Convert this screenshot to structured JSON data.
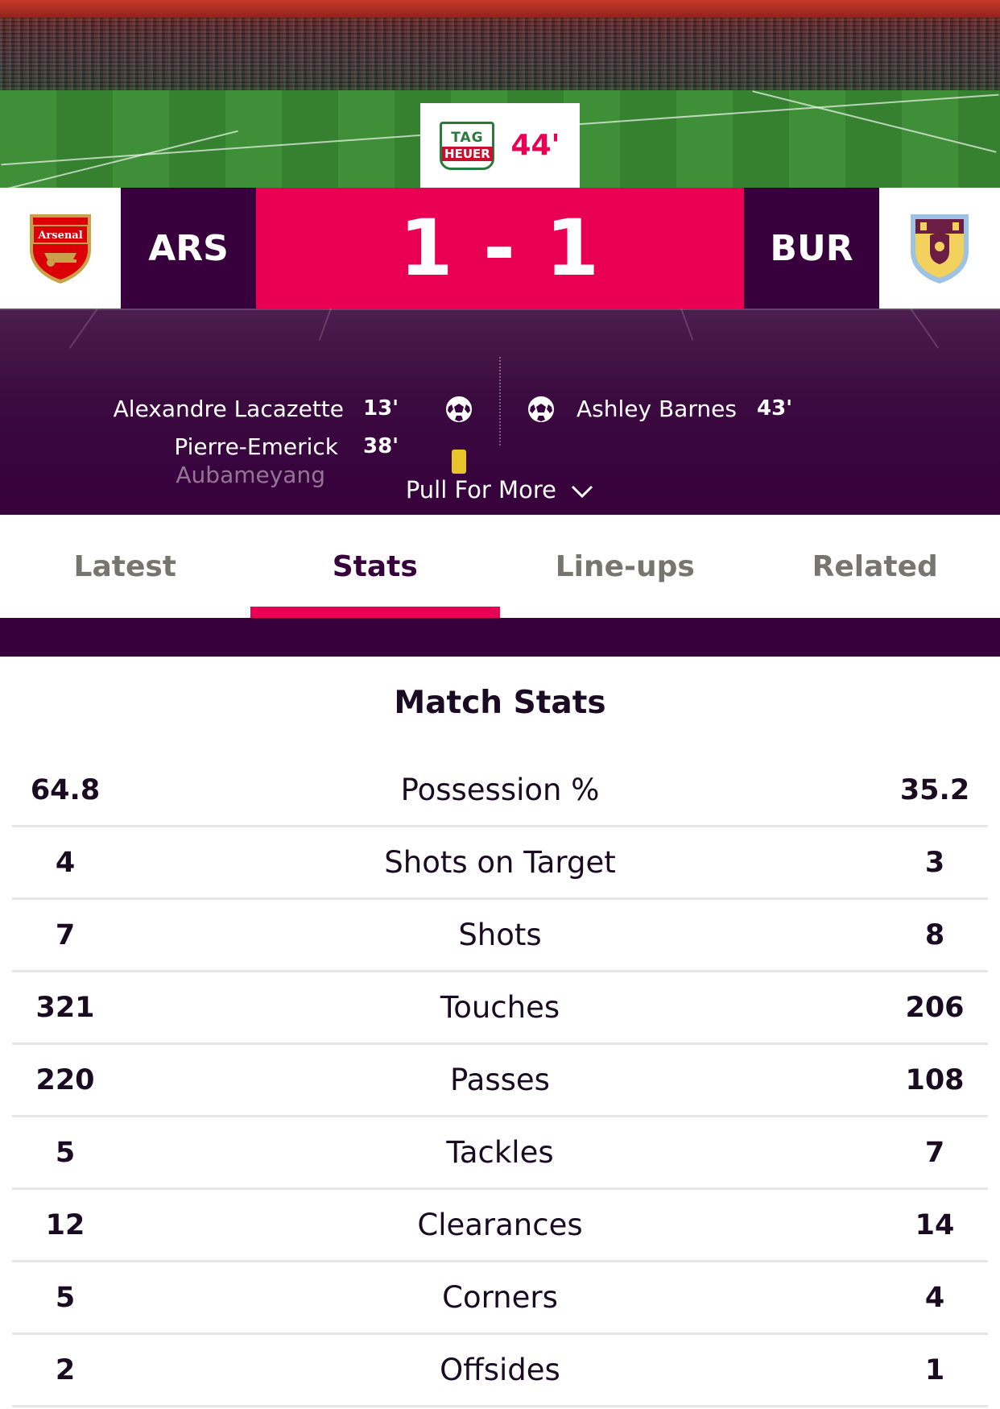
{
  "match": {
    "minute": "44'",
    "sponsor_top": "TAG",
    "sponsor_bottom": "HEUER",
    "home": {
      "abbr": "ARS",
      "crest_text": "Arsenal",
      "color": "#db0007"
    },
    "away": {
      "abbr": "BUR",
      "color": "#6c1d45"
    },
    "score": "1 - 1"
  },
  "goals": {
    "home": [
      {
        "player": "Alexandre Lacazette",
        "minute": "13'"
      },
      {
        "player": "Pierre-Emerick",
        "minute": "38'"
      },
      {
        "player": "Aubameyang",
        "minute": ""
      }
    ],
    "away": [
      {
        "player": "Ashley Barnes",
        "minute": "43'"
      }
    ],
    "pull_label": "Pull For More"
  },
  "tabs": [
    {
      "label": "Latest",
      "active": false
    },
    {
      "label": "Stats",
      "active": true
    },
    {
      "label": "Line-ups",
      "active": false
    },
    {
      "label": "Related",
      "active": false
    }
  ],
  "stats": {
    "title": "Match Stats",
    "rows": [
      {
        "home": "64.8",
        "label": "Possession %",
        "away": "35.2"
      },
      {
        "home": "4",
        "label": "Shots on Target",
        "away": "3"
      },
      {
        "home": "7",
        "label": "Shots",
        "away": "8"
      },
      {
        "home": "321",
        "label": "Touches",
        "away": "206"
      },
      {
        "home": "220",
        "label": "Passes",
        "away": "108"
      },
      {
        "home": "5",
        "label": "Tackles",
        "away": "7"
      },
      {
        "home": "12",
        "label": "Clearances",
        "away": "14"
      },
      {
        "home": "5",
        "label": "Corners",
        "away": "4"
      },
      {
        "home": "2",
        "label": "Offsides",
        "away": "1"
      }
    ]
  },
  "colors": {
    "accent": "#e90052",
    "brand": "#37003c",
    "yellow_card": "#e6c42a"
  },
  "icons": [
    "tag-heuer-logo",
    "arsenal-crest",
    "burnley-crest",
    "football-icon",
    "yellow-card-icon",
    "chevron-down-icon"
  ]
}
